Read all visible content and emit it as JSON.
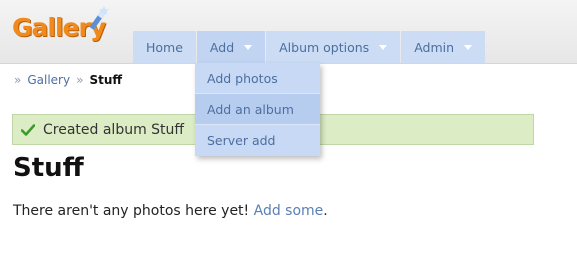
{
  "logo": {
    "text": "Gallery"
  },
  "nav": {
    "items": [
      {
        "label": "Home"
      },
      {
        "label": "Add"
      },
      {
        "label": "Album options"
      },
      {
        "label": "Admin"
      }
    ]
  },
  "add_menu": {
    "items": [
      {
        "label": "Add photos"
      },
      {
        "label": "Add an album"
      },
      {
        "label": "Server add"
      }
    ]
  },
  "breadcrumb": {
    "separator": "»",
    "items": [
      {
        "label": "Gallery"
      },
      {
        "label": "Stuff"
      }
    ]
  },
  "message": {
    "text": "Created album Stuff"
  },
  "page": {
    "title": "Stuff",
    "empty_text": "There aren't any photos here yet!",
    "add_link": "Add some",
    "period": "."
  },
  "colors": {
    "accent": "#4d6fa0",
    "nav_bg": "#cbdcf4",
    "success_bg": "#dcedc6",
    "logo": "#f08a1c"
  }
}
